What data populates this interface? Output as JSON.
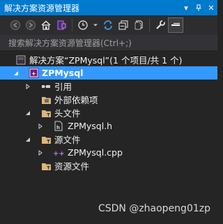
{
  "window": {
    "title": "解决方案资源管理器",
    "dropdown_glyph": "▾",
    "pin_glyph": "📌",
    "close_glyph": "✕"
  },
  "search": {
    "placeholder": "搜索解决方案资源管理器(Ctrl+;)"
  },
  "tree": {
    "solution": {
      "label": "解决方案“ZPMysql”(1 个项目/共 1 个)",
      "icon": "solution-icon"
    },
    "project": {
      "label": "ZPMysql",
      "icon": "cpp-project-icon",
      "expanded": true
    },
    "items": [
      {
        "label": "引用",
        "icon": "references-icon",
        "expandable": true,
        "expanded": false
      },
      {
        "label": "外部依赖项",
        "icon": "external-deps-icon",
        "expandable": false
      },
      {
        "label": "头文件",
        "icon": "filter-folder-icon",
        "expandable": true,
        "expanded": true
      },
      {
        "label": "ZPMysql.h",
        "icon": "header-file-icon",
        "expandable": true,
        "expanded": false
      },
      {
        "label": "源文件",
        "icon": "filter-folder-icon",
        "expandable": true,
        "expanded": true
      },
      {
        "label": "ZPMysql.cpp",
        "icon": "cpp-file-icon",
        "expandable": true,
        "expanded": false
      },
      {
        "label": "资源文件",
        "icon": "filter-folder-icon",
        "expandable": false
      }
    ]
  },
  "watermark": "CSDN @zhaopeng01zp",
  "colors": {
    "accent": "#007acc",
    "selection": "#3399ff",
    "background": "#252526",
    "folder": "#dcb67a"
  }
}
